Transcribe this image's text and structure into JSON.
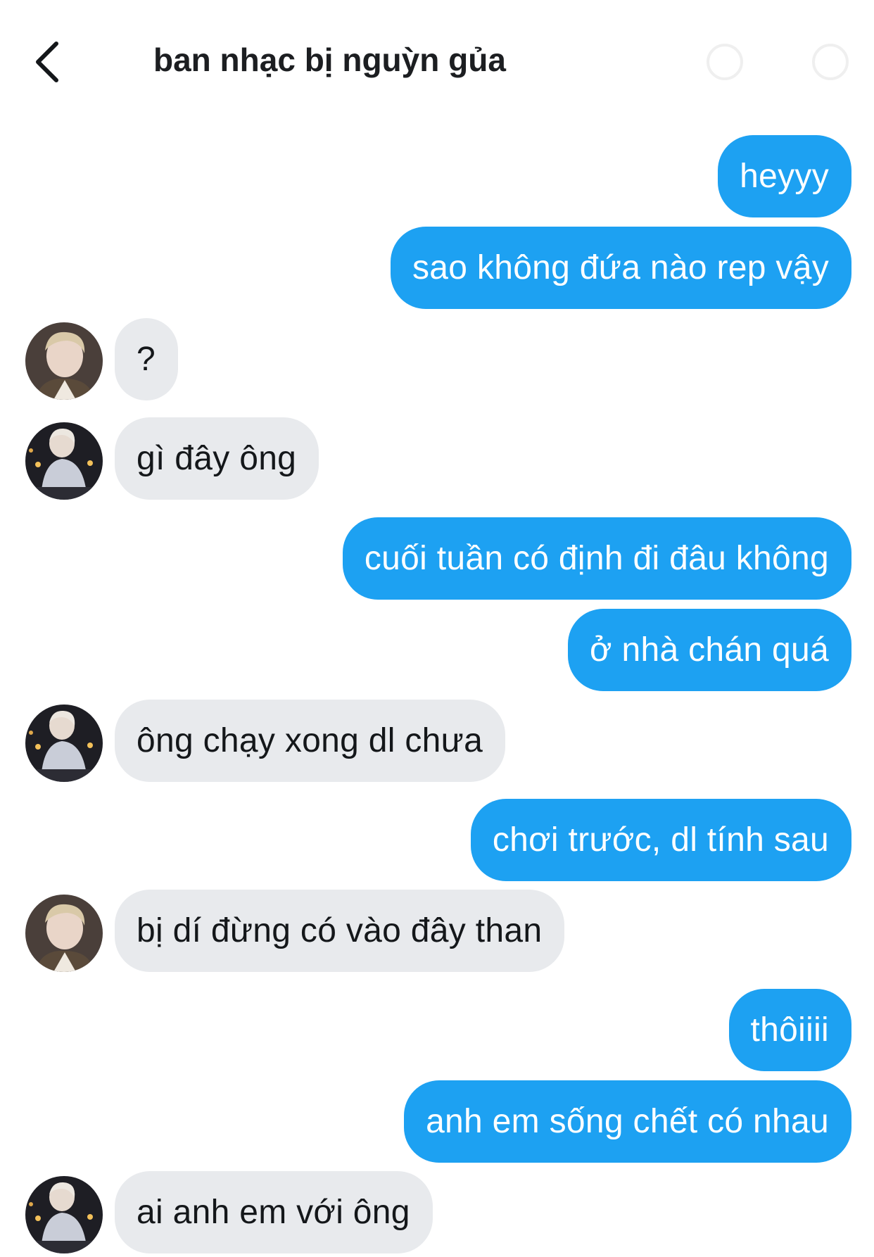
{
  "header": {
    "back_icon": "chevron-left-icon",
    "title": "ban nhạc bị nguỳn gủa",
    "right_icons": [
      "info-icon",
      "settings-icon"
    ]
  },
  "colors": {
    "outgoing_bubble": "#1da1f2",
    "incoming_bubble": "#e8eaed",
    "outgoing_text": "#ffffff",
    "incoming_text": "#14171a"
  },
  "messages": [
    {
      "dir": "out",
      "text": "heyyy"
    },
    {
      "dir": "out",
      "text": "sao không đứa nào rep vậy"
    },
    {
      "dir": "in",
      "avatar": "avatar-1",
      "text": "?"
    },
    {
      "dir": "in",
      "avatar": "avatar-2",
      "text": "gì đây ông"
    },
    {
      "dir": "out",
      "text": "cuối tuần có định đi đâu không"
    },
    {
      "dir": "out",
      "text": "ở nhà chán quá"
    },
    {
      "dir": "in",
      "avatar": "avatar-2",
      "text": "ông chạy xong dl chưa"
    },
    {
      "dir": "out",
      "text": "chơi trước, dl tính sau"
    },
    {
      "dir": "in",
      "avatar": "avatar-1",
      "text": "bị dí đừng có vào đây than"
    },
    {
      "dir": "out",
      "text": "thôiiii"
    },
    {
      "dir": "out",
      "text": "anh em sống chết có nhau"
    },
    {
      "dir": "in",
      "avatar": "avatar-2",
      "text": "ai anh em với ông"
    }
  ]
}
